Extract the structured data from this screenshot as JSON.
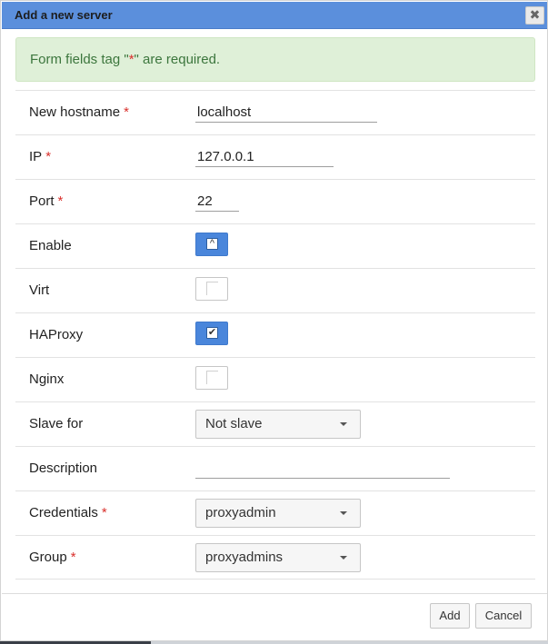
{
  "dialog": {
    "title": "Add a new server",
    "close_glyph": "✖"
  },
  "alert": {
    "prefix": "Form fields tag \"",
    "star": "*",
    "suffix": "\" are required."
  },
  "fields": {
    "hostname": {
      "label": "New hostname",
      "required": "*",
      "value": "localhost"
    },
    "ip": {
      "label": "IP",
      "required": "*",
      "value": "127.0.0.1"
    },
    "port": {
      "label": "Port",
      "required": "*",
      "value": "22"
    },
    "enable": {
      "label": "Enable",
      "checked": true,
      "glyph": "^"
    },
    "virt": {
      "label": "Virt",
      "checked": false
    },
    "haproxy": {
      "label": "HAProxy",
      "checked": true,
      "glyph": "✔"
    },
    "nginx": {
      "label": "Nginx",
      "checked": false
    },
    "slave_for": {
      "label": "Slave for",
      "value": "Not slave"
    },
    "description": {
      "label": "Description",
      "value": ""
    },
    "credentials": {
      "label": "Credentials",
      "required": "*",
      "value": "proxyadmin"
    },
    "group": {
      "label": "Group",
      "required": "*",
      "value": "proxyadmins"
    }
  },
  "buttons": {
    "add": "Add",
    "cancel": "Cancel"
  },
  "colors": {
    "titlebar": "#5b8fdc",
    "checkbox_on": "#4a86db",
    "required": "#d9302c",
    "alert_bg": "#dff0d8",
    "alert_text": "#3c763d"
  }
}
